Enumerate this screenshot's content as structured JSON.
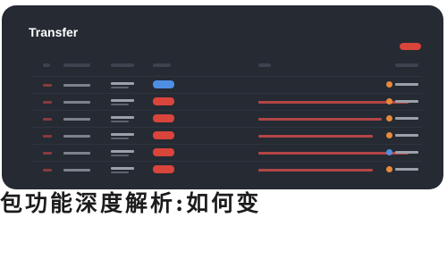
{
  "window": {
    "title": "Transfer"
  },
  "colors": {
    "background": "#252a33",
    "accent_red": "#d9443b",
    "accent_orange": "#e8893a",
    "accent_blue": "#4f8fe3",
    "accent_link": "#b34646"
  },
  "table": {
    "rows": [
      {
        "status": "blue",
        "dot": "orange"
      },
      {
        "status": "red",
        "dot": "orange"
      },
      {
        "status": "red",
        "dot": "orange"
      },
      {
        "status": "red",
        "dot": "orange"
      },
      {
        "status": "red",
        "dot": "blue"
      },
      {
        "status": "red",
        "dot": "orange"
      }
    ]
  },
  "banner": {
    "text": "包功能深度解析:如何变"
  }
}
